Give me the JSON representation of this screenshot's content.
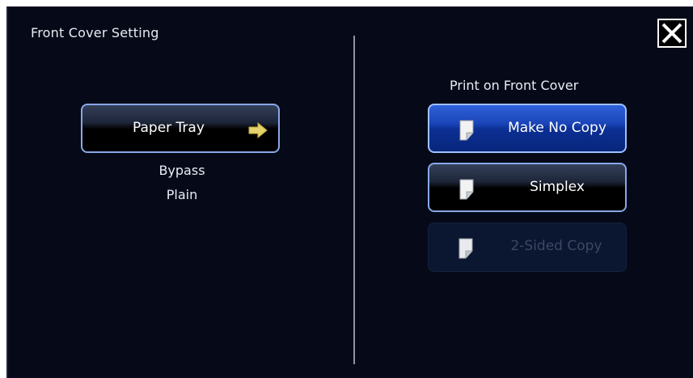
{
  "dialog": {
    "title": "Front Cover Setting",
    "close_icon": "close-icon"
  },
  "left": {
    "paper_tray_button": {
      "label": "Paper Tray",
      "icon": "arrow-right-icon",
      "icon_color": "#e5d36b"
    },
    "tray_value": "Bypass",
    "paper_type_value": "Plain"
  },
  "right": {
    "heading": "Print on Front Cover",
    "options": [
      {
        "label": "Make No Copy",
        "icon": "page-icon",
        "selected": true,
        "enabled": true
      },
      {
        "label": "Simplex",
        "icon": "page-icon",
        "selected": false,
        "enabled": true
      },
      {
        "label": "2-Sided Copy",
        "icon": "page-icon",
        "selected": false,
        "enabled": false
      }
    ]
  },
  "colors": {
    "background": "#060a18",
    "selected_accent": "#1a45b8",
    "button_border": "#8aa7e8"
  }
}
